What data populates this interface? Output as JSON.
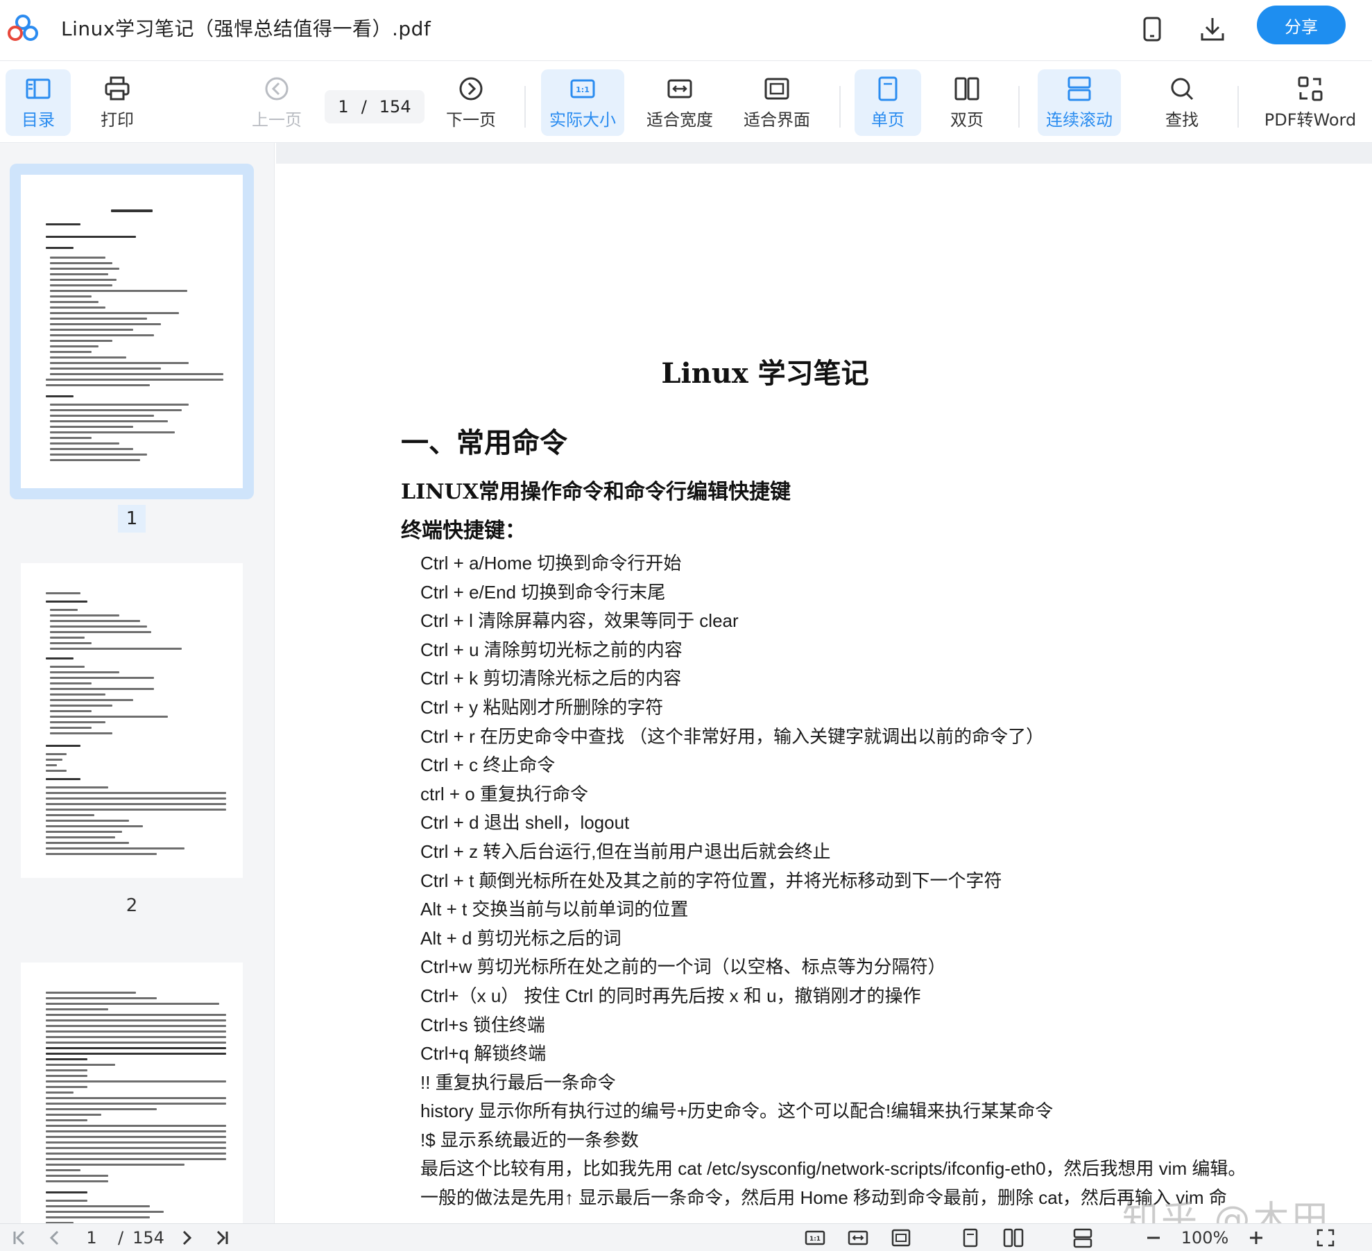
{
  "app": {
    "file_name": "Linux学习笔记（强悍总结值得一看）.pdf",
    "share_label": "分享",
    "brand_color": "#1e8ef0"
  },
  "header_icons": [
    "logo-icon",
    "phone-icon",
    "download-icon"
  ],
  "toolbar": {
    "toc": "目录",
    "print": "打印",
    "prev": "上一页",
    "page_current": "1",
    "page_sep": "/",
    "page_total": "154",
    "next": "下一页",
    "actual_size": "实际大小",
    "fit_width": "适合宽度",
    "fit_page": "适合界面",
    "single_page": "单页",
    "double_page": "双页",
    "continuous": "连续滚动",
    "search": "查找",
    "pdf_to_word": "PDF转Word"
  },
  "sidebar": {
    "thumbnails": [
      {
        "label": "1",
        "selected": true
      },
      {
        "label": "2",
        "selected": false
      },
      {
        "label": "",
        "selected": false
      }
    ]
  },
  "document": {
    "title": "Linux 学习笔记",
    "heading1": "一、常用命令",
    "heading2": "LINUX常用操作命令和命令行编辑快捷键",
    "heading3": "终端快捷键：",
    "lines": [
      "Ctrl + a/Home  切换到命令行开始",
      "Ctrl + e/End  切换到命令行末尾",
      "Ctrl + l  清除屏幕内容，效果等同于 clear",
      "Ctrl + u  清除剪切光标之前的内容",
      "Ctrl + k  剪切清除光标之后的内容",
      "Ctrl + y  粘贴刚才所删除的字符",
      "Ctrl + r  在历史命令中查找 （这个非常好用，输入关键字就调出以前的命令了）",
      "Ctrl + c  终止命令",
      "ctrl + o  重复执行命令",
      "Ctrl + d  退出 shell，logout",
      "Ctrl + z  转入后台运行,但在当前用户退出后就会终止",
      "Ctrl + t  颠倒光标所在处及其之前的字符位置，并将光标移动到下一个字符",
      "Alt + t  交换当前与以前单词的位置",
      "Alt + d  剪切光标之后的词",
      "Ctrl+w  剪切光标所在处之前的一个词（以空格、标点等为分隔符）",
      "Ctrl+（x u） 按住 Ctrl 的同时再先后按 x 和 u，撤销刚才的操作",
      "Ctrl+s  锁住终端",
      "Ctrl+q  解锁终端",
      "!!  重复执行最后一条命令",
      "history  显示你所有执行过的编号+历史命令。这个可以配合!编辑来执行某某命令",
      "!$  显示系统最近的一条参数",
      "最后这个比较有用，比如我先用 cat /etc/sysconfig/network-scripts/ifconfig-eth0，然后我想用 vim 编辑。",
      "一般的做法是先用↑ 显示最后一条命令，然后用 Home 移动到命令最前，删除 cat，然后再输入 vim 命"
    ],
    "watermark": "知乎 @木田"
  },
  "bottom": {
    "page_current": "1",
    "page_sep": "/",
    "page_total": "154",
    "zoom": "100%"
  }
}
